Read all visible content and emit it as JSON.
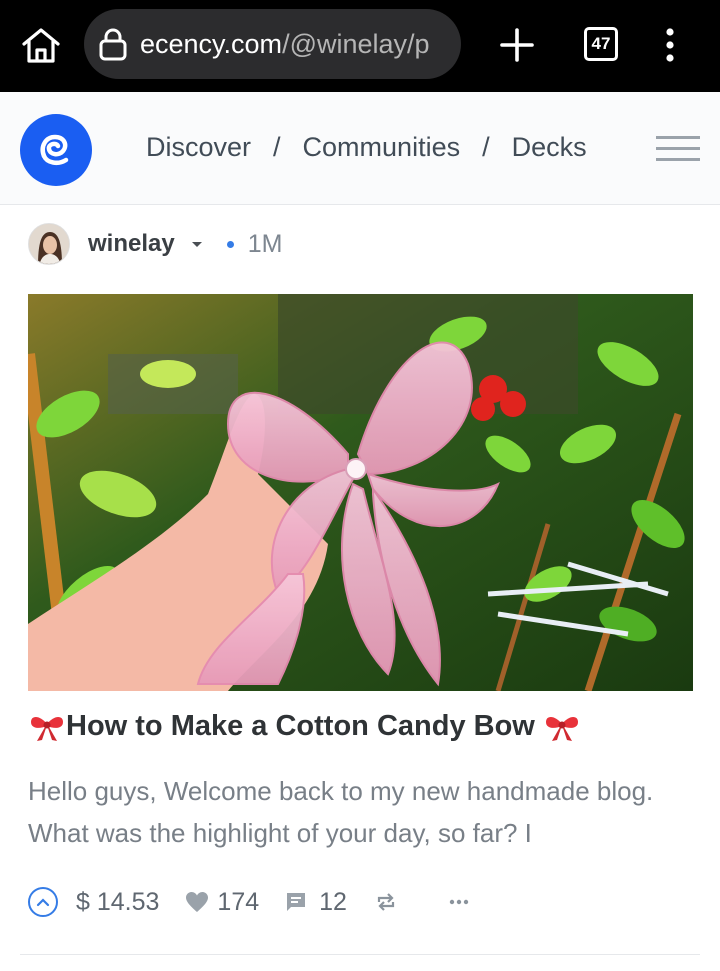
{
  "browser": {
    "url_domain": "ecency.com",
    "url_path": "/@winelay/p",
    "tab_count": "47"
  },
  "nav": {
    "links": [
      "Discover",
      "Communities",
      "Decks"
    ],
    "separator": "/"
  },
  "post": {
    "author": "winelay",
    "age": "1M",
    "title": "How to Make a Cotton Candy Bow",
    "title_emoji": "bow-ribbon",
    "excerpt": "Hello guys, Welcome back to my new handmade blog. What was the highlight of your day, so far? I",
    "payout": "$ 14.53",
    "likes": "174",
    "comments": "12"
  },
  "colors": {
    "brand": "#1a5ef2",
    "accent": "#357ce6"
  }
}
